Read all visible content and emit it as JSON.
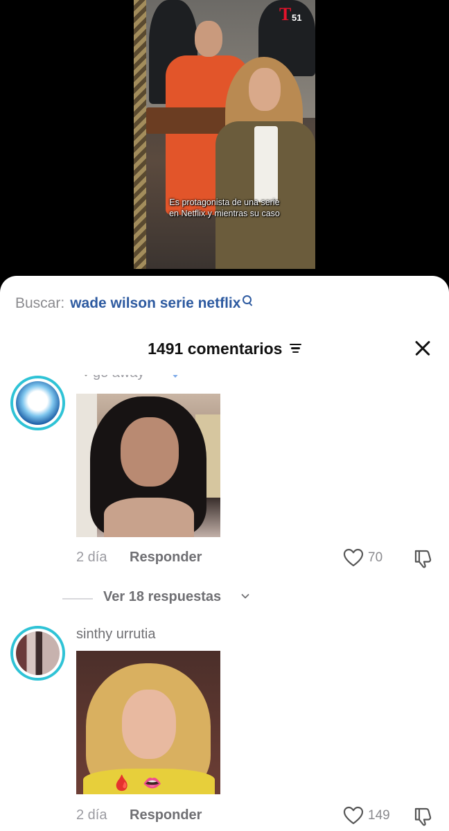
{
  "video": {
    "network_logo_letter": "T",
    "network_logo_number": "51",
    "caption_line1": "Es protagonista de una serie",
    "caption_line2": "en Netflix y mientras su caso"
  },
  "search": {
    "label": "Buscar:",
    "query": "wade wilson serie netflix"
  },
  "header": {
    "title": "1491 comentarios"
  },
  "comments": [
    {
      "username": "go away",
      "time": "2 día",
      "reply_label": "Responder",
      "likes": "70",
      "view_replies": "Ver 18 respuestas"
    },
    {
      "username": "sinthy urrutia",
      "time": "2 día",
      "reply_label": "Responder",
      "likes": "149"
    }
  ],
  "colors": {
    "link": "#2d5aa0",
    "avatar_ring": "#2fc3d6",
    "muted_text": "#8a8a8e"
  }
}
